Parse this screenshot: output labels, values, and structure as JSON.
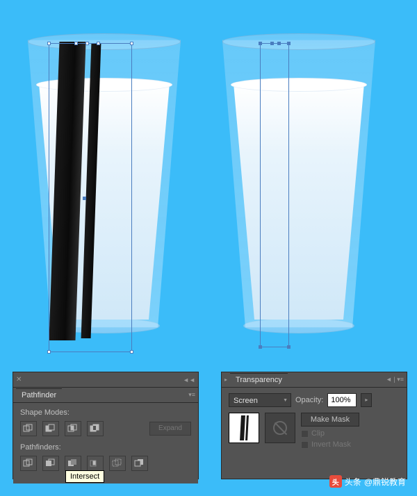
{
  "pathfinder": {
    "title": "Pathfinder",
    "shape_modes_label": "Shape Modes:",
    "pathfinders_label": "Pathfinders:",
    "expand_label": "Expand",
    "tooltip": "Intersect"
  },
  "transparency": {
    "title": "Transparency",
    "blend_mode": "Screen",
    "opacity_label": "Opacity:",
    "opacity_value": "100%",
    "make_mask_label": "Make Mask",
    "clip_label": "Clip",
    "invert_mask_label": "Invert Mask"
  },
  "watermark": {
    "prefix": "头条",
    "author": "@鼎锐教育"
  }
}
